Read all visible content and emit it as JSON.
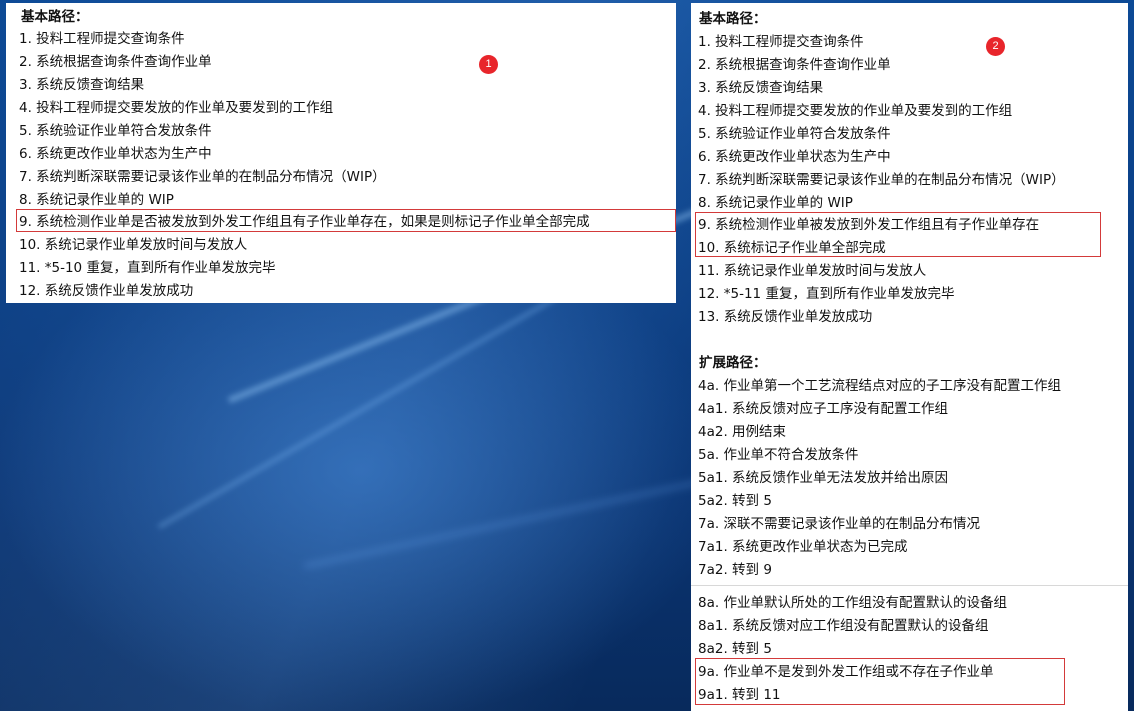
{
  "panel1": {
    "badge": "1",
    "heading": "基本路径：",
    "lines": [
      "1.  投料工程师提交查询条件",
      "2.  系统根据查询条件查询作业单",
      "3.  系统反馈查询结果",
      "4.  投料工程师提交要发放的作业单及要发到的工作组",
      "5.  系统验证作业单符合发放条件",
      "6.  系统更改作业单状态为生产中",
      "7.  系统判断深联需要记录该作业单的在制品分布情况（WIP）",
      "8.  系统记录作业单的 WIP",
      "9.  系统检测作业单是否被发放到外发工作组且有子作业单存在，如果是则标记子作业单全部完成",
      "10.  系统记录作业单发放时间与发放人",
      "11.  *5-10 重复，直到所有作业单发放完毕",
      "12.  系统反馈作业单发放成功"
    ]
  },
  "panel2": {
    "badge": "2",
    "heading": "基本路径：",
    "lines": [
      "1.  投料工程师提交查询条件",
      "2.  系统根据查询条件查询作业单",
      "3.  系统反馈查询结果",
      "4.  投料工程师提交要发放的作业单及要发到的工作组",
      "5.  系统验证作业单符合发放条件",
      "6.  系统更改作业单状态为生产中",
      "7.  系统判断深联需要记录该作业单的在制品分布情况（WIP）",
      "8.  系统记录作业单的 WIP",
      "9.  系统检测作业单被发放到外发工作组且有子作业单存在",
      "10.  系统标记子作业单全部完成",
      "11.  系统记录作业单发放时间与发放人",
      "12.  *5-11 重复，直到所有作业单发放完毕",
      "13.  系统反馈作业单发放成功"
    ],
    "ext_heading": "扩展路径：",
    "ext_lines": [
      "4a.  作业单第一个工艺流程结点对应的子工序没有配置工作组",
      "4a1.  系统反馈对应子工序没有配置工作组",
      "4a2.  用例结束",
      "5a.  作业单不符合发放条件",
      "5a1.  系统反馈作业单无法发放并给出原因",
      "5a2.  转到 5",
      "7a.  深联不需要记录该作业单的在制品分布情况",
      "7a1.  系统更改作业单状态为已完成",
      "7a2.  转到 9",
      "8a.  作业单默认所处的工作组没有配置默认的设备组",
      "8a1.  系统反馈对应工作组没有配置默认的设备组",
      "8a2.  转到 5",
      "9a.  作业单不是发到外发工作组或不存在子作业单",
      "9a1.  转到 11"
    ]
  },
  "colors": {
    "highlight_border": "#d33a3a",
    "badge": "#e8252b",
    "desktop_blue": "#0a3a78"
  }
}
